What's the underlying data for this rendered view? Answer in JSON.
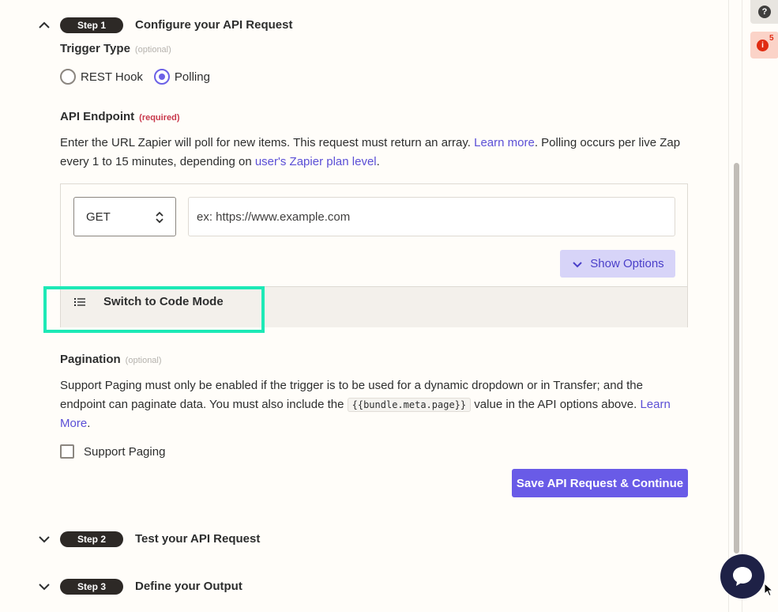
{
  "steps": [
    {
      "pill": "Step 1",
      "title": "Configure your API Request",
      "expanded": true
    },
    {
      "pill": "Step 2",
      "title": "Test your API Request",
      "expanded": false
    },
    {
      "pill": "Step 3",
      "title": "Define your Output",
      "expanded": false
    }
  ],
  "trigger_type": {
    "label": "Trigger Type",
    "tag": "(optional)",
    "options": [
      {
        "label": "REST Hook",
        "selected": false
      },
      {
        "label": "Polling",
        "selected": true
      }
    ]
  },
  "endpoint": {
    "label": "API Endpoint",
    "tag": "(required)",
    "desc_part1": "Enter the URL Zapier will poll for new items. This request must return an array.",
    "learn_more": "Learn more",
    "desc_part2": ". Polling occurs per live Zap every 1 to 15 minutes, depending on",
    "plan_link": "user's Zapier plan level",
    "desc_end": ".",
    "method": "GET",
    "url_placeholder": "ex: https://www.example.com",
    "show_options": "Show Options",
    "code_mode": "Switch to Code Mode"
  },
  "pagination": {
    "label": "Pagination",
    "tag": "(optional)",
    "desc_part1": "Support Paging must only be enabled if the trigger is to be used for a dynamic dropdown or in Transfer; and the endpoint can paginate data. You must also include the",
    "code": "{{bundle.meta.page}}",
    "desc_part2": "value in the API options above.",
    "learn_more": "Learn More",
    "desc_end": ".",
    "checkbox_label": "Support Paging"
  },
  "save_button": "Save API Request & Continue",
  "rail": {
    "help": "?",
    "alert_icon": "i",
    "alert_count": "5"
  },
  "colors": {
    "accent": "#695be7",
    "highlight": "#1de9b6",
    "pill": "#2d2926",
    "alert": "#e02b12"
  }
}
